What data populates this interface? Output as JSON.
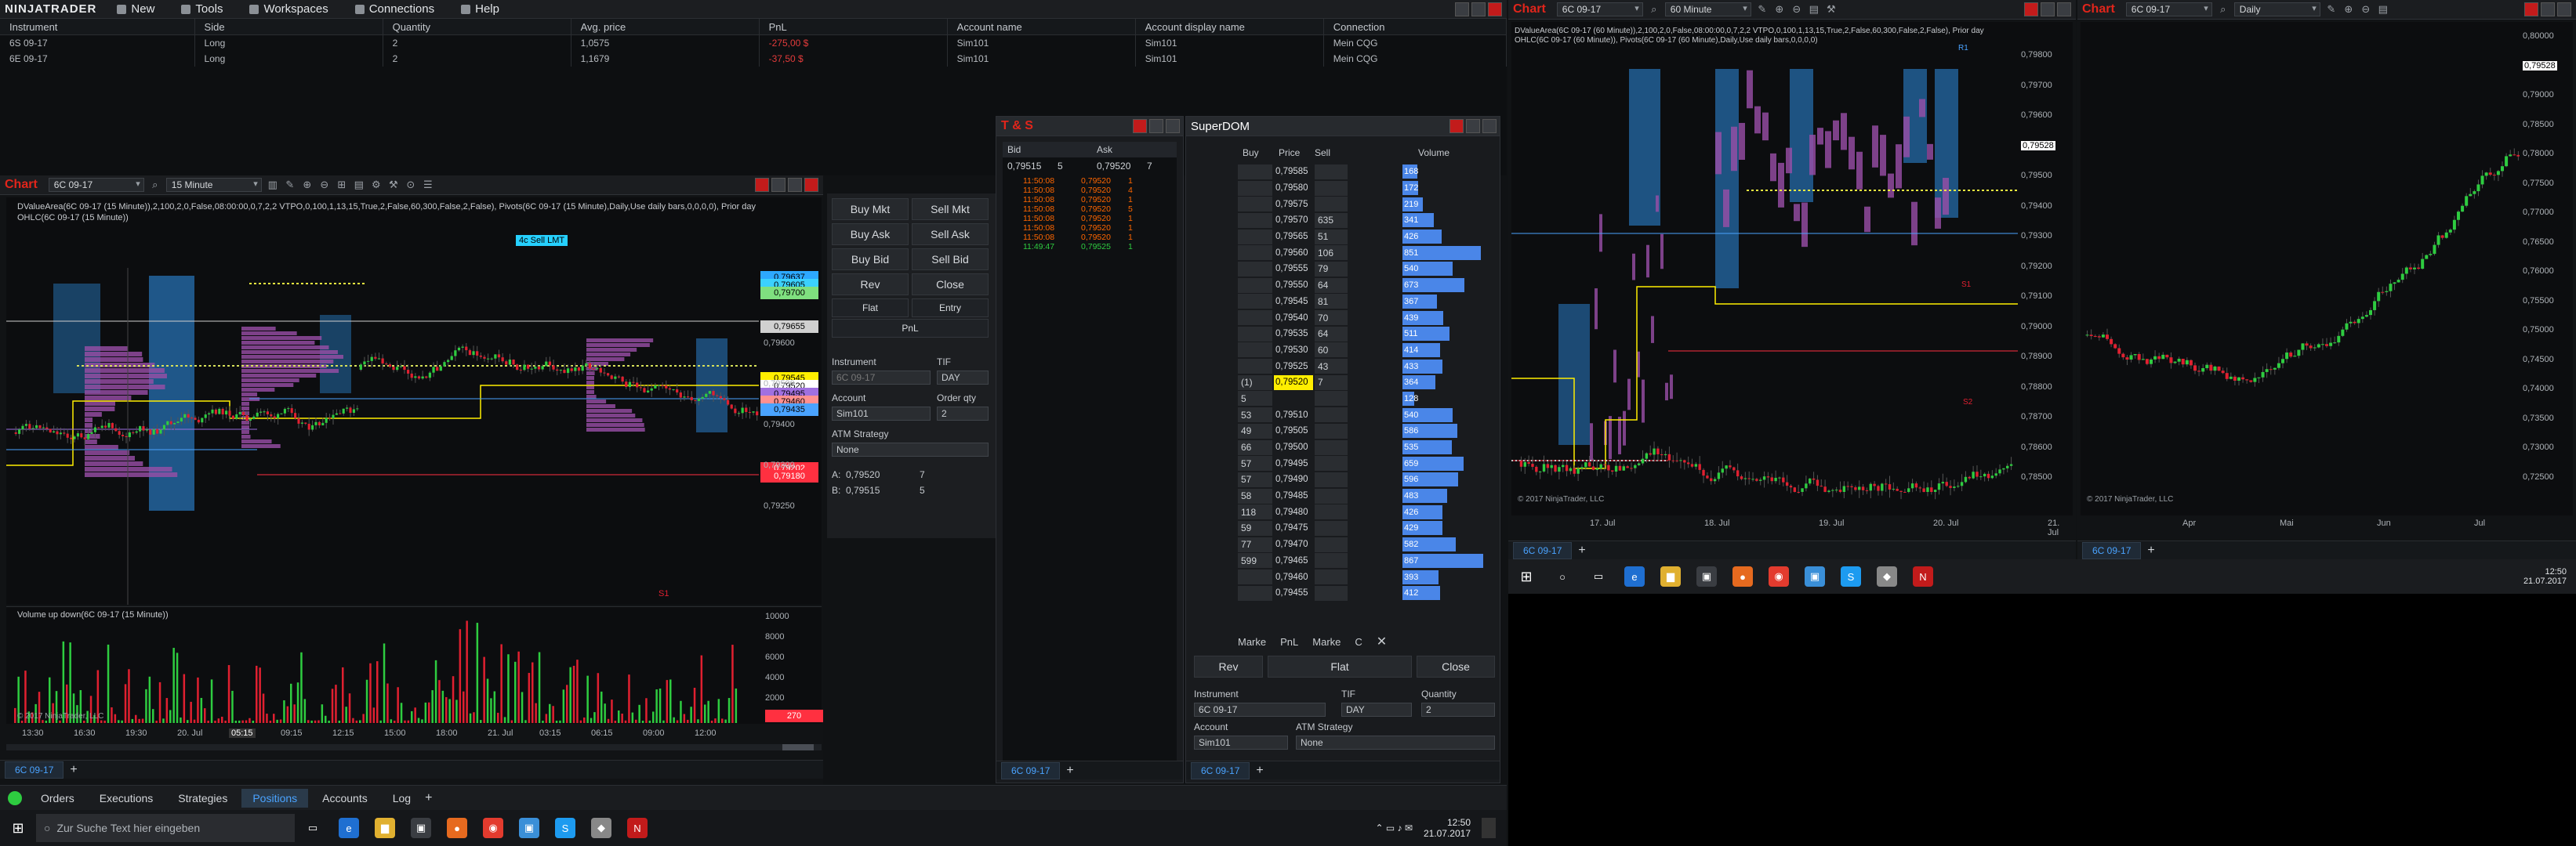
{
  "app": {
    "logo_text": "NINJATRADER",
    "menu": [
      {
        "label": "New",
        "icon": "new-icon"
      },
      {
        "label": "Tools",
        "icon": "tools-icon"
      },
      {
        "label": "Workspaces",
        "icon": "workspaces-icon"
      },
      {
        "label": "Connections",
        "icon": "connections-icon"
      },
      {
        "label": "Help",
        "icon": "help-icon"
      }
    ]
  },
  "positions": {
    "columns": [
      "Instrument",
      "Side",
      "Quantity",
      "Avg. price",
      "PnL",
      "Account name",
      "Account display name",
      "Connection"
    ],
    "rows": [
      [
        "6S 09-17",
        "Long",
        "2",
        "1,0575",
        "-275,00 $",
        "Sim101",
        "Sim101",
        "Mein CQG"
      ],
      [
        "6E 09-17",
        "Long",
        "2",
        "1,1679",
        "-37,50 $",
        "Sim101",
        "Sim101",
        "Mein CQG"
      ]
    ]
  },
  "chart1": {
    "title": "Chart",
    "instrument": "6C 09-17",
    "interval": "15 Minute",
    "info_line1": "DValueArea(6C 09-17 (15 Minute)),2,100,2,0,False,08:00:00,0,7,2,2 VTPO,0,100,1,13,15,True,2,False,60,300,False,2,False), Pivots(6C 09-17 (15 Minute),Daily,Use daily bars,0,0,0,0), Prior day",
    "info_line2": "OHLC(6C 09-17 (15 Minute))",
    "order_marker": "4c Sell LMT",
    "y_ticks": [
      "0,79600",
      "0,79500",
      "0,79400",
      "0,79300",
      "0,79250"
    ],
    "price_flags": [
      {
        "text": "0,79637",
        "color": "#2da8ff"
      },
      {
        "text": "0,79605",
        "color": "#3bd1ff"
      },
      {
        "text": "0,79700",
        "color": "#7fe07f"
      },
      {
        "text": "0,79655",
        "color": "#d0d0d0"
      },
      {
        "text": "0,79545",
        "color": "#ffee00"
      },
      {
        "text": "0,79520",
        "color": "#ffffff"
      },
      {
        "text": "0,79495",
        "color": "#a070e0"
      },
      {
        "text": "0,79460",
        "color": "#ff9090"
      },
      {
        "text": "0,79435",
        "color": "#4aa3ff"
      },
      {
        "text": "0,79202",
        "color": "#ff3040"
      },
      {
        "text": "0,79180",
        "color": "#ff3040"
      }
    ],
    "s1_label": "S1",
    "vol_title": "Volume up down(6C 09-17 (15 Minute))",
    "vol_ticks": [
      "10000",
      "8000",
      "6000",
      "4000",
      "2000"
    ],
    "vol_flag": "270",
    "copyright": "© 2017 NinjaTrader, LLC",
    "x_ticks": [
      "13:30",
      "16:30",
      "19:30",
      "20. Jul",
      "05:15",
      "09:15",
      "12:15",
      "15:00",
      "18:00",
      "21. Jul",
      "03:15",
      "06:15",
      "09:00",
      "12:00"
    ],
    "tab": "6C 09-17"
  },
  "chart_trader": {
    "buttons": [
      "Buy Mkt",
      "Sell Mkt",
      "Buy Ask",
      "Sell Ask",
      "Buy Bid",
      "Sell Bid",
      "Rev",
      "Close",
      "Flat",
      "Entry",
      "PnL"
    ],
    "instrument_label": "Instrument",
    "tif_label": "TIF",
    "instrument": "6C 09-17",
    "tif": "DAY",
    "account_label": "Account",
    "orderqty_label": "Order qty",
    "account": "Sim101",
    "qty": "2",
    "atm_label": "ATM Strategy",
    "atm": "None",
    "a_label": "A:",
    "a_price": "0,79520",
    "a_size": "7",
    "b_label": "B:",
    "b_price": "0,79515",
    "b_size": "5"
  },
  "ts": {
    "title": "T & S",
    "bid_label": "Bid",
    "ask_label": "Ask",
    "bid_price": "0,79515",
    "bid_size": "5",
    "ask_price": "0,79520",
    "ask_size": "7",
    "rows": [
      [
        "11:50:08",
        "0,79520",
        "1",
        "#ff6600"
      ],
      [
        "11:50:08",
        "0,79520",
        "4",
        "#ff6600"
      ],
      [
        "11:50:08",
        "0,79520",
        "1",
        "#ff6600"
      ],
      [
        "11:50:08",
        "0,79520",
        "5",
        "#ff6600"
      ],
      [
        "11:50:08",
        "0,79520",
        "1",
        "#ff6600"
      ],
      [
        "11:50:08",
        "0,79520",
        "1",
        "#ff6600"
      ],
      [
        "11:50:08",
        "0,79520",
        "1",
        "#ff6600"
      ],
      [
        "11:49:47",
        "0,79525",
        "1",
        "#2ecc40"
      ]
    ],
    "tab": "6C 09-17"
  },
  "dom": {
    "title": "SuperDOM",
    "headers": [
      "Buy",
      "Price",
      "Sell",
      "Volume"
    ],
    "rows": [
      {
        "buy": "",
        "price": "0,79585",
        "sell": "",
        "vol": "168",
        "vf": 0.16
      },
      {
        "buy": "",
        "price": "0,79580",
        "sell": "",
        "vol": "172",
        "vf": 0.17
      },
      {
        "buy": "",
        "price": "0,79575",
        "sell": "",
        "vol": "219",
        "vf": 0.22
      },
      {
        "buy": "",
        "price": "0,79570",
        "sell": "635",
        "vol": "341",
        "vf": 0.34
      },
      {
        "buy": "",
        "price": "0,79565",
        "sell": "51",
        "vol": "426",
        "vf": 0.42
      },
      {
        "buy": "",
        "price": "0,79560",
        "sell": "106",
        "vol": "851",
        "vf": 0.85
      },
      {
        "buy": "",
        "price": "0,79555",
        "sell": "79",
        "vol": "540",
        "vf": 0.54
      },
      {
        "buy": "",
        "price": "0,79550",
        "sell": "64",
        "vol": "673",
        "vf": 0.67
      },
      {
        "buy": "",
        "price": "0,79545",
        "sell": "81",
        "vol": "367",
        "vf": 0.37
      },
      {
        "buy": "",
        "price": "0,79540",
        "sell": "70",
        "vol": "439",
        "vf": 0.44
      },
      {
        "buy": "",
        "price": "0,79535",
        "sell": "64",
        "vol": "511",
        "vf": 0.51
      },
      {
        "buy": "",
        "price": "0,79530",
        "sell": "60",
        "vol": "414",
        "vf": 0.41
      },
      {
        "buy": "",
        "price": "0,79525",
        "sell": "43",
        "vol": "433",
        "vf": 0.43
      },
      {
        "buy": "(1)",
        "price": "0,79520",
        "sell": "7",
        "vol": "364",
        "vf": 0.36,
        "hl": true
      },
      {
        "buy": "5",
        "price": "",
        "sell": "",
        "vol": "128",
        "vf": 0.13
      },
      {
        "buy": "53",
        "price": "0,79510",
        "sell": "",
        "vol": "540",
        "vf": 0.54
      },
      {
        "buy": "49",
        "price": "0,79505",
        "sell": "",
        "vol": "586",
        "vf": 0.59
      },
      {
        "buy": "66",
        "price": "0,79500",
        "sell": "",
        "vol": "535",
        "vf": 0.53
      },
      {
        "buy": "57",
        "price": "0,79495",
        "sell": "",
        "vol": "659",
        "vf": 0.66
      },
      {
        "buy": "57",
        "price": "0,79490",
        "sell": "",
        "vol": "596",
        "vf": 0.6
      },
      {
        "buy": "58",
        "price": "0,79485",
        "sell": "",
        "vol": "483",
        "vf": 0.48
      },
      {
        "buy": "118",
        "price": "0,79480",
        "sell": "",
        "vol": "426",
        "vf": 0.43
      },
      {
        "buy": "59",
        "price": "0,79475",
        "sell": "",
        "vol": "429",
        "vf": 0.43
      },
      {
        "buy": "77",
        "price": "0,79470",
        "sell": "",
        "vol": "582",
        "vf": 0.58
      },
      {
        "buy": "599",
        "price": "0,79465",
        "sell": "",
        "vol": "867",
        "vf": 0.87
      },
      {
        "buy": "",
        "price": "0,79460",
        "sell": "",
        "vol": "393",
        "vf": 0.39
      },
      {
        "buy": "",
        "price": "0,79455",
        "sell": "",
        "vol": "412",
        "vf": 0.41
      }
    ],
    "footer": [
      "Marke",
      "PnL",
      "Marke",
      "C"
    ],
    "buttons": [
      "Rev",
      "Flat",
      "Close"
    ],
    "instrument_label": "Instrument",
    "tif_label": "TIF",
    "quantity_label": "Quantity",
    "instrument": "6C 09-17",
    "tif": "DAY",
    "qty": "2",
    "account_label": "Account",
    "atm_label": "ATM Strategy",
    "account": "Sim101",
    "atm": "None",
    "tab": "6C 09-17"
  },
  "chart2": {
    "title": "Chart",
    "instrument": "6C 09-17",
    "interval": "60 Minute",
    "info_line1": "DValueArea(6C 09-17 (60 Minute)),2,100,2,0,False,08:00:00,0,7,2,2 VTPO,0,100,1,13,15,True,2,False,60,300,False,2,False), Prior day",
    "info_line2": "OHLC(6C 09-17 (60 Minute)), Pivots(6C 09-17 (60 Minute),Daily,Use daily bars,0,0,0,0)",
    "y_ticks": [
      "0,79800",
      "0,79700",
      "0,79600",
      "0,79528",
      "0,79500",
      "0,79400",
      "0,79300",
      "0,79200",
      "0,79100",
      "0,79000",
      "0,78900",
      "0,78800",
      "0,78700",
      "0,78600",
      "0,78500"
    ],
    "x_ticks": [
      "17. Jul",
      "18. Jul",
      "19. Jul",
      "20. Jul",
      "21. Jul"
    ],
    "labels": [
      "R1",
      "S1",
      "S2"
    ],
    "copyright": "© 2017 NinjaTrader, LLC",
    "tab": "6C 09-17"
  },
  "chart3": {
    "title": "Chart",
    "instrument": "6C 09-17",
    "interval": "Daily",
    "y_ticks": [
      "0,80000",
      "0,79528",
      "0,79000",
      "0,78500",
      "0,78000",
      "0,77500",
      "0,77000",
      "0,76500",
      "0,76000",
      "0,75500",
      "0,75000",
      "0,74500",
      "0,74000",
      "0,73500",
      "0,73000",
      "0,72500"
    ],
    "x_ticks": [
      "Apr",
      "Mai",
      "Jun",
      "Jul"
    ],
    "copyright": "© 2017 NinjaTrader, LLC",
    "tab": "6C 09-17"
  },
  "bottom_tabs": [
    "Orders",
    "Executions",
    "Strategies",
    "Positions",
    "Accounts",
    "Log"
  ],
  "taskbar": {
    "search_placeholder": "Zur Suche Text hier eingeben",
    "time": "12:50",
    "date": "21.07.2017"
  },
  "colors": {
    "accent": "#4aa3ff",
    "brand_red": "#e1251b",
    "value_area": "#2a6aa8",
    "vtpo": "#9a4fa8",
    "up": "#2ecc40",
    "down": "#e02030",
    "yellow": "#ffee00"
  }
}
